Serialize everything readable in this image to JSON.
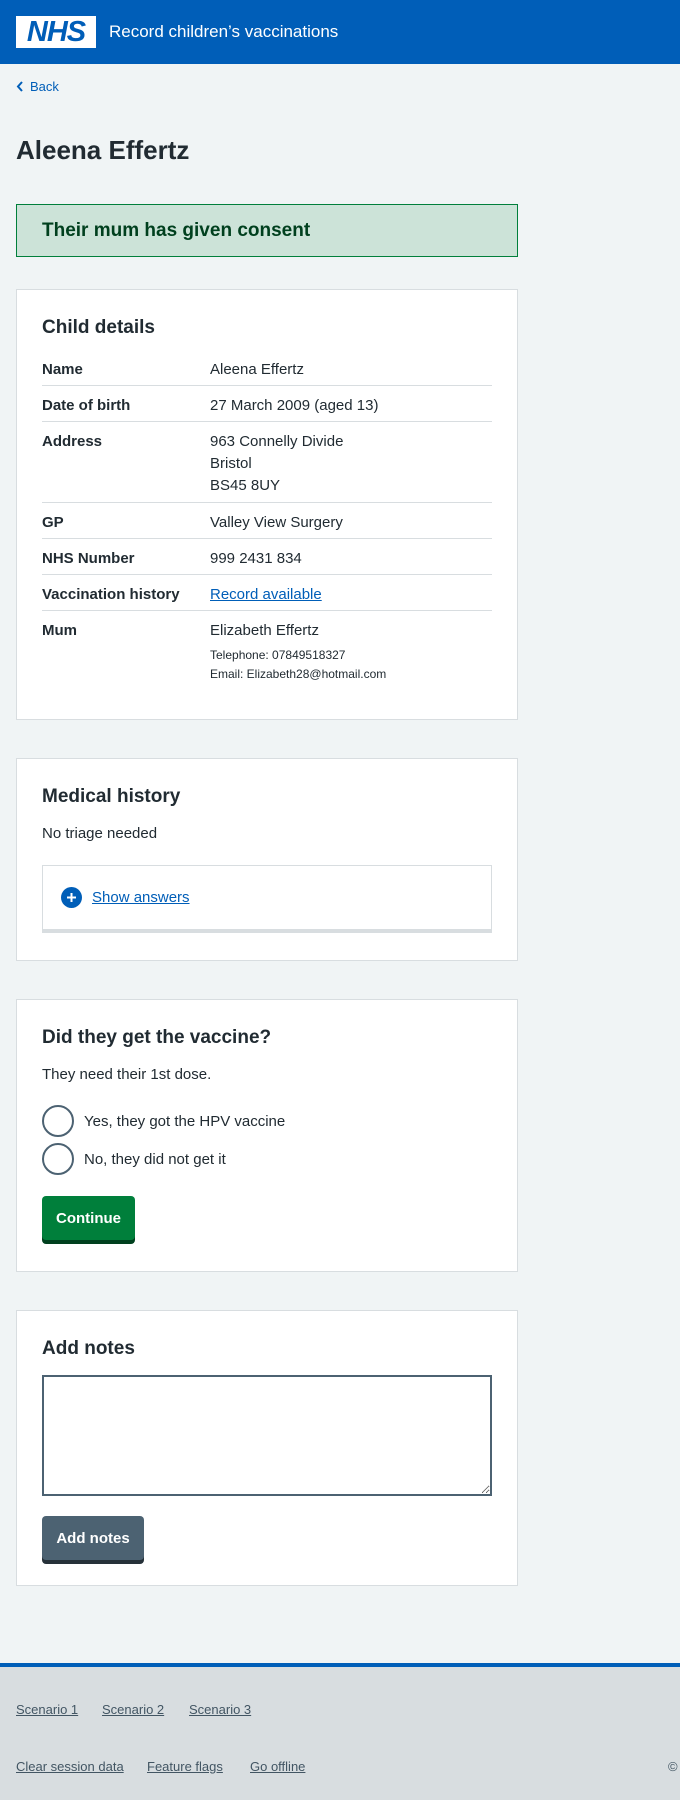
{
  "header": {
    "logo": "NHS",
    "service_name": "Record children’s vaccinations"
  },
  "back_link": "Back",
  "page_title": "Aleena Effertz",
  "consent_banner": "Their mum has given consent",
  "child_details": {
    "title": "Child details",
    "rows": [
      {
        "key": "Name",
        "value": "Aleena Effertz"
      },
      {
        "key": "Date of birth",
        "value": "27 March 2009 (aged 13)"
      },
      {
        "key": "Address",
        "lines": [
          "963 Connelly Divide",
          "Bristol",
          "BS45 8UY"
        ]
      },
      {
        "key": "GP",
        "value": "Valley View Surgery"
      },
      {
        "key": "NHS Number",
        "value": "999 2431 834"
      },
      {
        "key": "Vaccination history",
        "value": "Record available"
      },
      {
        "key": "Mum",
        "value": "Elizabeth Effertz",
        "telephone": "Telephone: 07849518327",
        "email": "Email: Elizabeth28@hotmail.com"
      }
    ]
  },
  "medical_history": {
    "title": "Medical history",
    "status": "No triage needed",
    "show_answers": "Show answers"
  },
  "vaccine_question": {
    "title": "Did they get the vaccine?",
    "hint": "They need their 1st dose.",
    "options": [
      "Yes, they got the HPV vaccine",
      "No, they did not get it"
    ],
    "continue_label": "Continue"
  },
  "notes": {
    "title": "Add notes",
    "textarea_value": "",
    "button_label": "Add notes"
  },
  "footer": {
    "scenarios": [
      "Scenario 1",
      "Scenario 2",
      "Scenario 3"
    ],
    "links": [
      "Clear session data",
      "Feature flags",
      "Go offline"
    ],
    "copyright": "©"
  },
  "colors": {
    "brand": "#005eb8",
    "success": "#007f3b",
    "secondary": "#4c6272"
  }
}
